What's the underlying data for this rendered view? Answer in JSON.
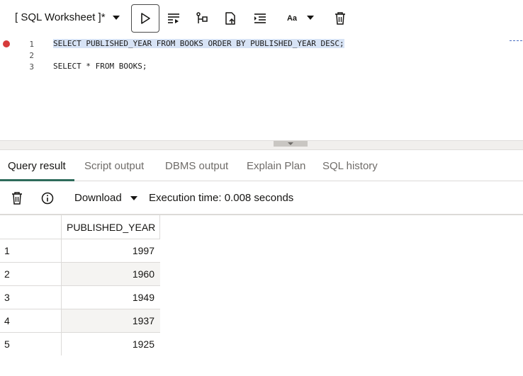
{
  "toolbar": {
    "worksheet_title": "[ SQL Worksheet ]*",
    "buttons": [
      {
        "name": "run-statement",
        "icon": "play-icon"
      },
      {
        "name": "run-script",
        "icon": "run-script-icon"
      },
      {
        "name": "explain-plan",
        "icon": "explain-plan-icon"
      },
      {
        "name": "autotrace",
        "icon": "autotrace-icon"
      },
      {
        "name": "format",
        "icon": "format-indent-icon"
      },
      {
        "name": "text-case",
        "icon": "text-case-icon",
        "label": "Aa"
      },
      {
        "name": "clear",
        "icon": "trash-icon"
      }
    ]
  },
  "editor": {
    "lines": [
      {
        "number": "1",
        "text": "SELECT PUBLISHED_YEAR FROM BOOKS ORDER BY PUBLISHED_YEAR DESC;",
        "breakpoint": true
      },
      {
        "number": "2",
        "text": ""
      },
      {
        "number": "3",
        "text": "SELECT * FROM BOOKS;"
      }
    ]
  },
  "tabs": [
    {
      "label": "Query result",
      "active": true
    },
    {
      "label": "Script output"
    },
    {
      "label": "DBMS output"
    },
    {
      "label": "Explain Plan"
    },
    {
      "label": "SQL history"
    }
  ],
  "result_toolbar": {
    "download_label": "Download",
    "execution_time": "Execution time: 0.008 seconds"
  },
  "grid": {
    "columns": [
      "PUBLISHED_YEAR"
    ],
    "rows": [
      {
        "n": "1",
        "value": "1997"
      },
      {
        "n": "2",
        "value": "1960"
      },
      {
        "n": "3",
        "value": "1949"
      },
      {
        "n": "4",
        "value": "1937"
      },
      {
        "n": "5",
        "value": "1925"
      }
    ]
  },
  "colors": {
    "accent_tab": "#2e6b5b",
    "breakpoint": "#d63b3b",
    "selection": "#d7e3f5",
    "keyword": "#1a3fa0"
  }
}
